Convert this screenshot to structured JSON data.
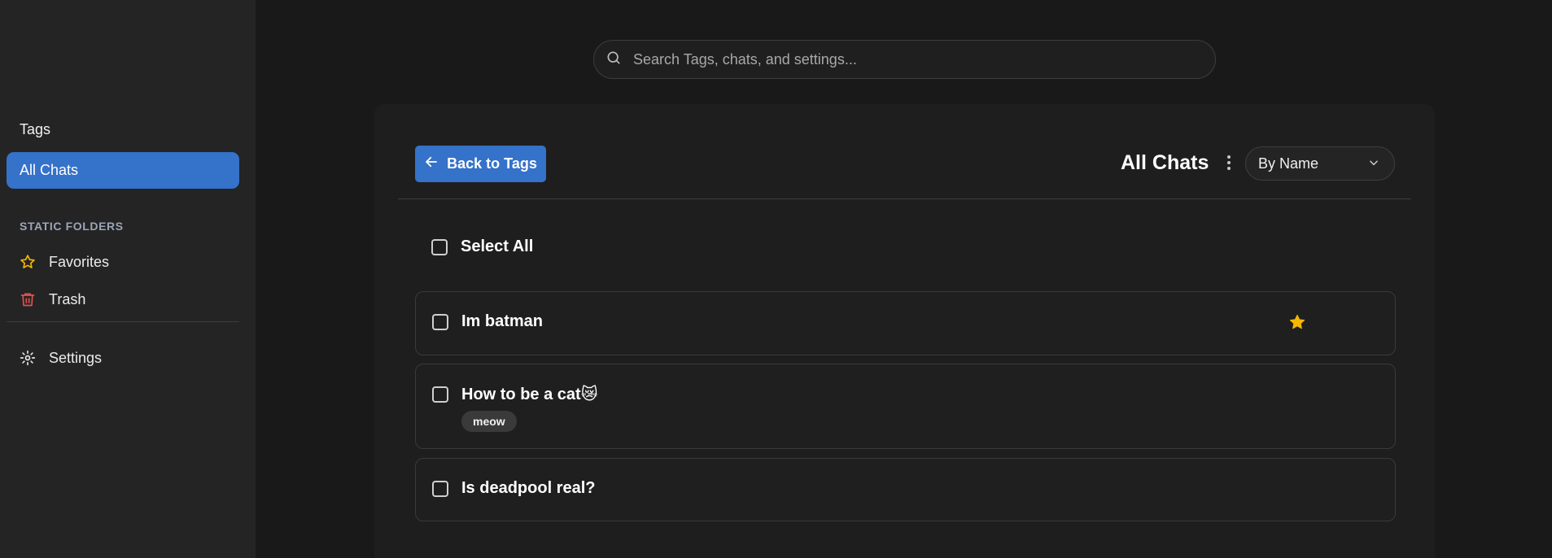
{
  "sidebar": {
    "tags_label": "Tags",
    "all_chats_label": "All Chats",
    "section_title": "STATIC FOLDERS",
    "favorites_label": "Favorites",
    "trash_label": "Trash",
    "settings_label": "Settings"
  },
  "search": {
    "placeholder": "Search Tags, chats, and settings..."
  },
  "panel": {
    "back_label": "Back to Tags",
    "title": "All Chats",
    "sort_value": "By Name",
    "select_all_label": "Select All"
  },
  "chats": [
    {
      "title": "Im batman",
      "favorite": true,
      "tags": []
    },
    {
      "title": "How to be a cat😿",
      "favorite": false,
      "tags": [
        "meow"
      ]
    },
    {
      "title": "Is deadpool real?",
      "favorite": false,
      "tags": []
    }
  ],
  "colors": {
    "accent": "#3572c9",
    "favorite_star": "#f5b800",
    "trash": "#e05252"
  },
  "icons": {
    "favorites": "star-outline-icon",
    "trash": "trash-icon",
    "settings": "gear-icon",
    "search": "search-icon",
    "back": "arrow-left-icon",
    "more": "more-vertical-icon",
    "sort": "chevron-down-icon",
    "favorite_chat": "star-filled-icon"
  }
}
